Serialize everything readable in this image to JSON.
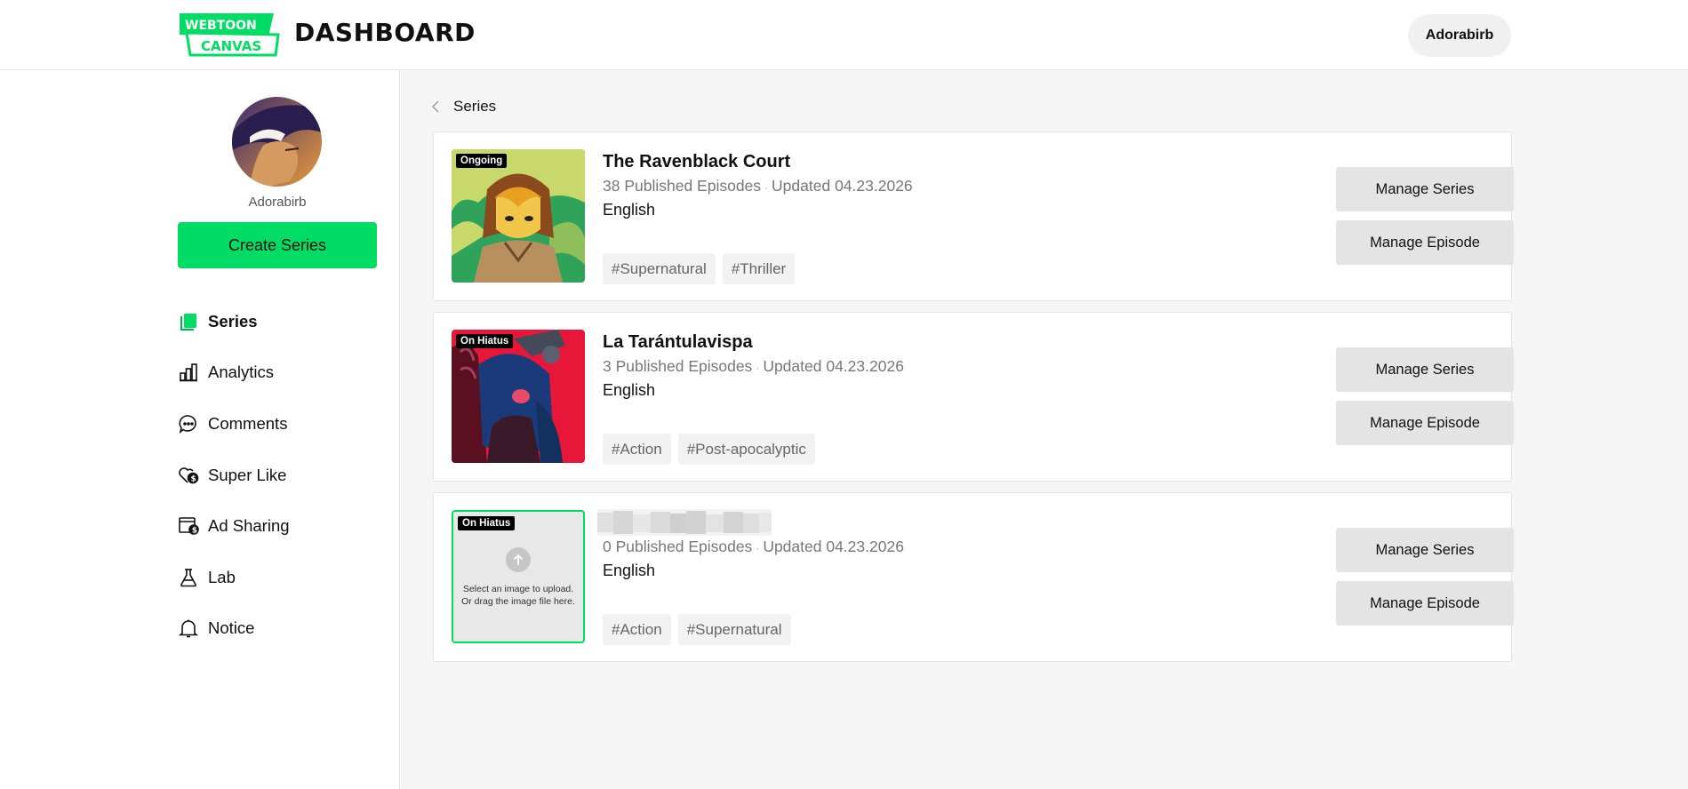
{
  "header": {
    "logo_line1": "WEBTOON",
    "logo_line2": "CANVAS",
    "title": "DASHBOARD",
    "user": "Adorabirb"
  },
  "sidebar": {
    "profile_name": "Adorabirb",
    "create_label": "Create Series",
    "items": [
      {
        "label": "Series",
        "icon": "series-icon",
        "active": true
      },
      {
        "label": "Analytics",
        "icon": "analytics-icon",
        "active": false
      },
      {
        "label": "Comments",
        "icon": "comments-icon",
        "active": false
      },
      {
        "label": "Super Like",
        "icon": "super-like-icon",
        "active": false
      },
      {
        "label": "Ad Sharing",
        "icon": "ad-sharing-icon",
        "active": false
      },
      {
        "label": "Lab",
        "icon": "lab-icon",
        "active": false
      },
      {
        "label": "Notice",
        "icon": "notice-icon",
        "active": false
      }
    ]
  },
  "main": {
    "breadcrumb": "Series",
    "series": [
      {
        "status": "Ongoing",
        "title": "The Ravenblack Court",
        "episodes": "38 Published Episodes",
        "updated": "Updated 04.23.2026",
        "language": "English",
        "tags": [
          "#Supernatural",
          "#Thriller"
        ],
        "manage_series": "Manage Series",
        "manage_episode": "Manage Episode"
      },
      {
        "status": "On Hiatus",
        "title": "La Tarántulavispa",
        "episodes": "3 Published Episodes",
        "updated": "Updated 04.23.2026",
        "language": "English",
        "tags": [
          "#Action",
          "#Post-apocalyptic"
        ],
        "manage_series": "Manage Series",
        "manage_episode": "Manage Episode"
      },
      {
        "status": "On Hiatus",
        "title": "",
        "episodes": "0 Published Episodes",
        "updated": "Updated 04.23.2026",
        "language": "English",
        "tags": [
          "#Action",
          "#Supernatural"
        ],
        "upload_line1": "Select an image to upload.",
        "upload_line2": "Or drag the image file here.",
        "manage_series": "Manage Series",
        "manage_episode": "Manage Episode"
      }
    ]
  },
  "colors": {
    "accent": "#00dc64",
    "background": "#f5f5f5"
  }
}
